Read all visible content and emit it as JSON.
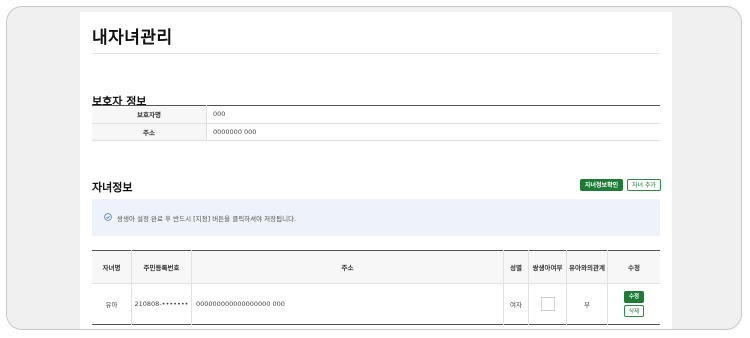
{
  "page": {
    "title": "내자녀관리"
  },
  "guardian": {
    "section_title": "보호자 정보",
    "rows": [
      {
        "label": "보호자명",
        "value": "000"
      },
      {
        "label": "주소",
        "value": "0000000 000"
      }
    ]
  },
  "children": {
    "section_title": "자녀정보",
    "confirm_button": "자녀정보확인",
    "add_button": "자녀 추가",
    "notice": "쌍생아 설정 완료 후 반드시 [지정] 버튼을 클릭하셔야 저장됩니다.",
    "columns": [
      "자녀명",
      "주민등록번호",
      "주소",
      "성별",
      "쌍생아여부",
      "유아와의관계",
      "수정"
    ],
    "rows": [
      {
        "name": "유아",
        "rrn": "210808-•••••••",
        "address": "000000000000000000 000",
        "gender": "여자",
        "relation": "부",
        "edit_label": "수정",
        "delete_label": "삭제"
      }
    ]
  }
}
